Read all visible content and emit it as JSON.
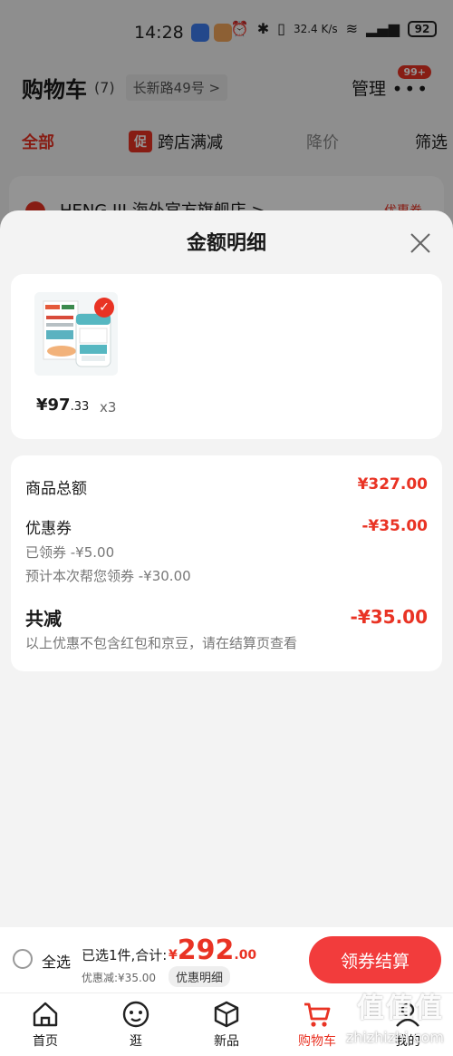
{
  "status_bar": {
    "time": "14:28",
    "net_speed": "32.4 K/s",
    "battery": "92",
    "icons": [
      "alarm-icon",
      "bluetooth-icon",
      "vibrate-icon",
      "wifi-icon",
      "signal-icon",
      "battery-icon"
    ]
  },
  "cart_header": {
    "title": "购物车",
    "count": "(7)",
    "address": "长新路49号 >",
    "manage_label": "管理",
    "badge": "99+"
  },
  "filter_tabs": {
    "all": "全部",
    "promo_tag": "促",
    "cross_store": "跨店满减",
    "price_drop": "降价",
    "filter": "筛选"
  },
  "shop": {
    "name": "HENG III 海外官方旗舰店 >",
    "coupon": "优惠券"
  },
  "sheet": {
    "title": "金额明细",
    "product": {
      "price_int": "¥97",
      "price_dec": ".33",
      "quantity": "x3"
    },
    "summary": {
      "goods_total_label": "商品总额",
      "goods_total_value": "¥327.00",
      "coupon_label": "优惠券",
      "coupon_value": "-¥35.00",
      "coupon_received": "已领券 -¥5.00",
      "coupon_estimated": "预计本次帮您领券 -¥30.00",
      "total_reduction_label": "共减",
      "total_reduction_value": "-¥35.00",
      "note": "以上优惠不包含红包和京豆，请在结算页查看"
    }
  },
  "checkout": {
    "select_all": "全选",
    "selected_text": "已选1件,合计:",
    "total_currency": "¥",
    "total_int": "292",
    "total_dec": ".00",
    "discount": "优惠减:¥35.00",
    "detail_link": "优惠明细",
    "button": "领券结算"
  },
  "nav": [
    {
      "label": "首页",
      "icon": "home-icon"
    },
    {
      "label": "逛",
      "icon": "browse-icon"
    },
    {
      "label": "新品",
      "icon": "new-products-icon"
    },
    {
      "label": "购物车",
      "icon": "cart-icon"
    },
    {
      "label": "我的",
      "icon": "profile-icon"
    }
  ],
  "watermark": {
    "text": "值值值",
    "url": "zhizhizhi.com"
  },
  "colors": {
    "accent": "#e93324",
    "button": "#f23c3c"
  }
}
